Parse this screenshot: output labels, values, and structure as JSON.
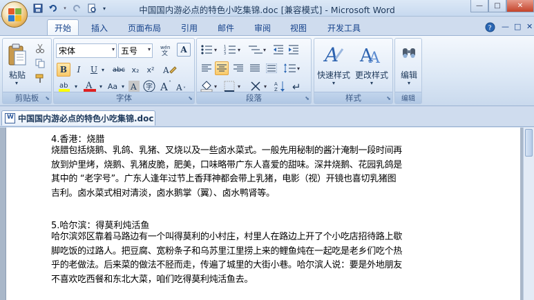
{
  "window": {
    "title": "中国国内游必点的特色小吃集锦.doc [兼容模式] - Microsoft Word",
    "controls": {
      "minimize": "—",
      "maximize": "□",
      "close": "✕"
    }
  },
  "ribbon_tabs": [
    "开始",
    "插入",
    "页面布局",
    "引用",
    "邮件",
    "审阅",
    "视图",
    "开发工具"
  ],
  "active_tab": "开始",
  "ribbon": {
    "clipboard": {
      "label": "剪贴板",
      "paste": "粘贴"
    },
    "font": {
      "label": "字体",
      "font_name": "宋体",
      "font_size": "五号",
      "wen": "wén",
      "bold": "B",
      "italic": "I",
      "underline": "U",
      "strike": "abc",
      "sub": "x₂",
      "sup": "x²",
      "case": "Aa",
      "grow": "A",
      "shrink": "A",
      "clear": "A"
    },
    "paragraph": {
      "label": "段落"
    },
    "styles": {
      "label": "样式",
      "quick_styles": "快速样式",
      "change_styles": "更改样式"
    },
    "editing": {
      "label": "编辑",
      "edit": "编辑"
    }
  },
  "document_tab": "中国国内游必点的特色小吃集锦.doc",
  "document": {
    "sections": [
      {
        "heading": "4.香港：烧腊",
        "lines": [
          "烧腊包括烧鹅、乳鸽、乳猪、叉烧以及一些卤水菜式。一般先用秘制的酱汁淹制一段时间再",
          "放到炉里烤，烧鹅、乳猪皮脆，肥美，口味略带广东人喜爱的甜味。深井烧鹅、花园乳鸽是",
          "其中的 “老字号”。广东人逢年过节上香拜神都会带上乳猪，电影（视）开镜也喜切乳猪图",
          "吉利。卤水菜式相对清淡，卤水鹅掌（翼）、卤水鸭肾等。"
        ]
      },
      {
        "heading": "5.哈尔滨：得莫利炖活鱼",
        "lines": [
          "哈尔滨郊区靠着马路边有一个叫得莫利的小村庄，村里人在路边上开了个小吃店招待路上歇",
          "脚吃饭的过路人。把豆腐、宽粉条子和乌苏里江里捞上来的鲤鱼炖在一起吃是老乡们吃个热",
          "乎的老做法。后来菜的做法不胫而走，传遍了城里的大街小巷。哈尔滨人说：要是外地朋友",
          "不喜欢吃西餐和东北大菜，咱们吃得莫利炖活鱼去。"
        ]
      }
    ]
  },
  "colors": {
    "ribbon_bg": "#dbe7f5",
    "title_bg": "#c7d9ef",
    "accent": "#15428b",
    "active_btn": "#f8c96b"
  }
}
